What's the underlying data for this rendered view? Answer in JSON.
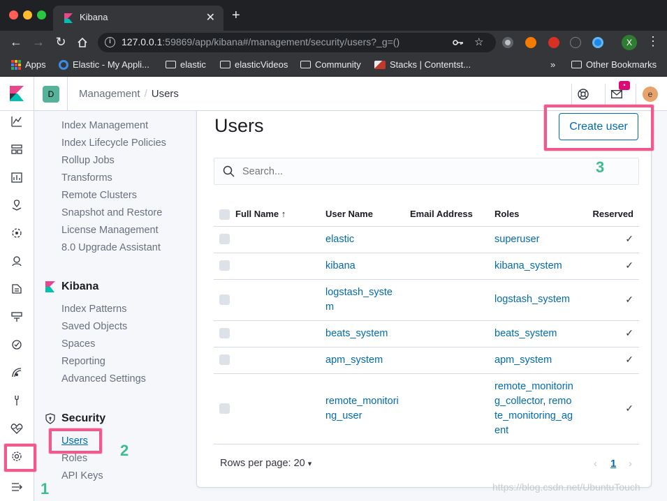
{
  "browser": {
    "tab_title": "Kibana",
    "tab_close": "✕",
    "new_tab": "+",
    "url_host": "127.0.0.1",
    "url_rest": ":59869/app/kibana#/management/security/users?_g=()",
    "bookmarks": [
      "Apps",
      "Elastic - My Appli...",
      "elastic",
      "elasticVideos",
      "Community",
      "Stacks | Contentst..."
    ],
    "bookmarks_overflow": "»",
    "other_bookmarks": "Other Bookmarks",
    "profile_initial": "X"
  },
  "header": {
    "space_initial": "D",
    "breadcrumbs": [
      "Management",
      "Users"
    ],
    "breadcrumb_separator": "/",
    "user_initial": "e"
  },
  "sidemenu": {
    "top_items": [
      "Index Management",
      "Index Lifecycle Policies",
      "Rollup Jobs",
      "Transforms",
      "Remote Clusters",
      "Snapshot and Restore",
      "License Management",
      "8.0 Upgrade Assistant"
    ],
    "kibana_title": "Kibana",
    "kibana_items": [
      "Index Patterns",
      "Saved Objects",
      "Spaces",
      "Reporting",
      "Advanced Settings"
    ],
    "security_title": "Security",
    "security_items": [
      "Users",
      "Roles",
      "API Keys"
    ]
  },
  "main": {
    "title": "Users",
    "create_button": "Create user",
    "search_placeholder": "Search...",
    "columns": {
      "full_name": "Full Name",
      "sort_indicator": "↑",
      "user_name": "User Name",
      "email": "Email Address",
      "roles": "Roles",
      "reserved": "Reserved"
    },
    "rows": [
      {
        "user_name": "elastic",
        "roles": "superuser",
        "reserved": "✓"
      },
      {
        "user_name": "kibana",
        "roles": "kibana_system",
        "reserved": "✓"
      },
      {
        "user_name": "logstash_system",
        "roles": "logstash_system",
        "reserved": "✓"
      },
      {
        "user_name": "beats_system",
        "roles": "beats_system",
        "reserved": "✓"
      },
      {
        "user_name": "apm_system",
        "roles": "apm_system",
        "reserved": "✓"
      },
      {
        "user_name": "remote_monitoring_user",
        "roles": "remote_monitoring_collector, remote_monitoring_agent",
        "roles_first": "remote_monitoring_collector",
        "roles_separator": ",",
        "roles_second": "remote_monitoring_agent",
        "reserved": "✓"
      }
    ],
    "rows_per_page_label": "Rows per page: 20",
    "current_page": "1"
  },
  "annotations": {
    "step1": "1",
    "step2": "2",
    "step3": "3",
    "color": "#ee5a8c",
    "number_color": "#3dbd8d"
  },
  "watermark": "https://blog.csdn.net/UbuntuTouch",
  "colors": {
    "link": "#006bb4",
    "kibana_pink": "#e8488b",
    "kibana_teal": "#00bfb3",
    "space_badge": "#54b399"
  }
}
